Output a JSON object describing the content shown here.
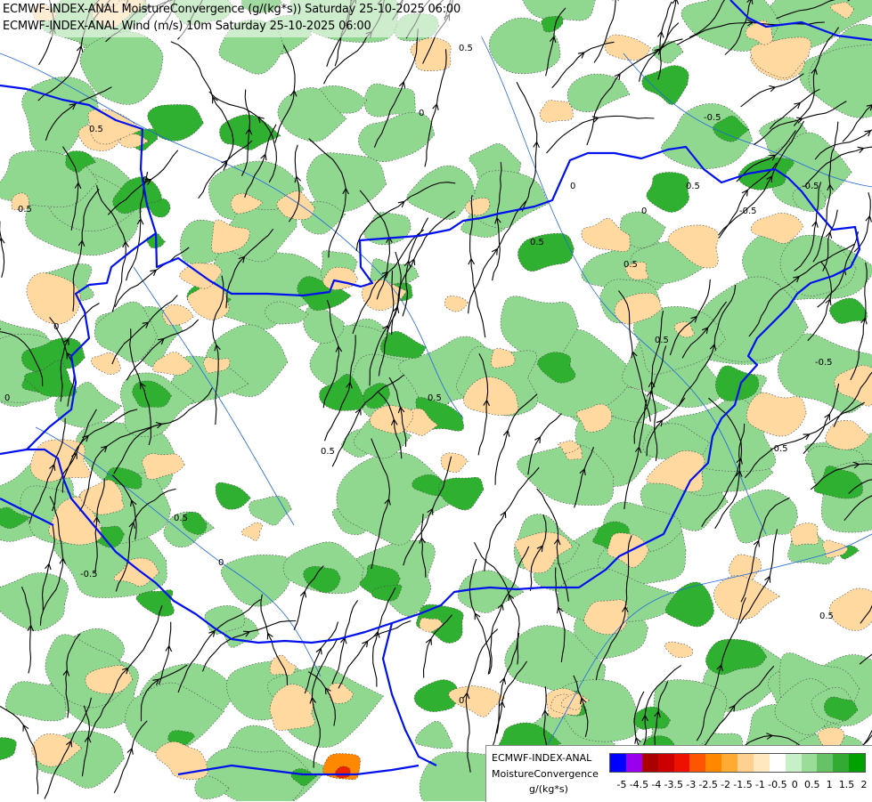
{
  "header": {
    "line1": "ECMWF-INDEX-ANAL MoistureConvergence (g/(kg*s)) Saturday 25-10-2025 06:00",
    "line2": "ECMWF-INDEX-ANAL Wind (m/s) 10m Saturday 25-10-2025 06:00"
  },
  "legend": {
    "model": "ECMWF-INDEX-ANAL",
    "parameter": "MoistureConvergence",
    "unit": "g/(kg*s)",
    "swatch_colors": [
      "#0000ff",
      "#9900ee",
      "#aa0000",
      "#cc0000",
      "#ee1100",
      "#ff5500",
      "#ff8800",
      "#ffaa33",
      "#ffd090",
      "#ffe8c0",
      "#ffffff",
      "#c8f0c8",
      "#99dd99",
      "#66c266",
      "#33aa33",
      "#00a000"
    ],
    "tick_labels": [
      "-5",
      "-4.5",
      "-4",
      "-3.5",
      "-3",
      "-2.5",
      "-2",
      "-1.5",
      "-1",
      "-0.5",
      "0",
      "0.5",
      "1",
      "1.5",
      "2"
    ]
  },
  "map": {
    "contour_labels": [
      "0.5",
      "0",
      "-0.5",
      "0.5",
      "0",
      "0.5",
      "-0.5",
      "0",
      "0.5",
      "0",
      "-0.5",
      "0.5",
      "0.5",
      "0",
      "0.5",
      "-0.5",
      "0",
      "0.5",
      "0.5",
      "-0.5",
      "0.5",
      "0",
      "-0.5",
      "0.5",
      "0"
    ],
    "colors": {
      "border": "#0011ee",
      "river": "#2266dd",
      "positive_fill": "#90d890",
      "positive_strong": "#30b030",
      "negative_fill": "#ffd9a0",
      "negative_strong": "#ff8800",
      "streamline": "#000000"
    }
  }
}
